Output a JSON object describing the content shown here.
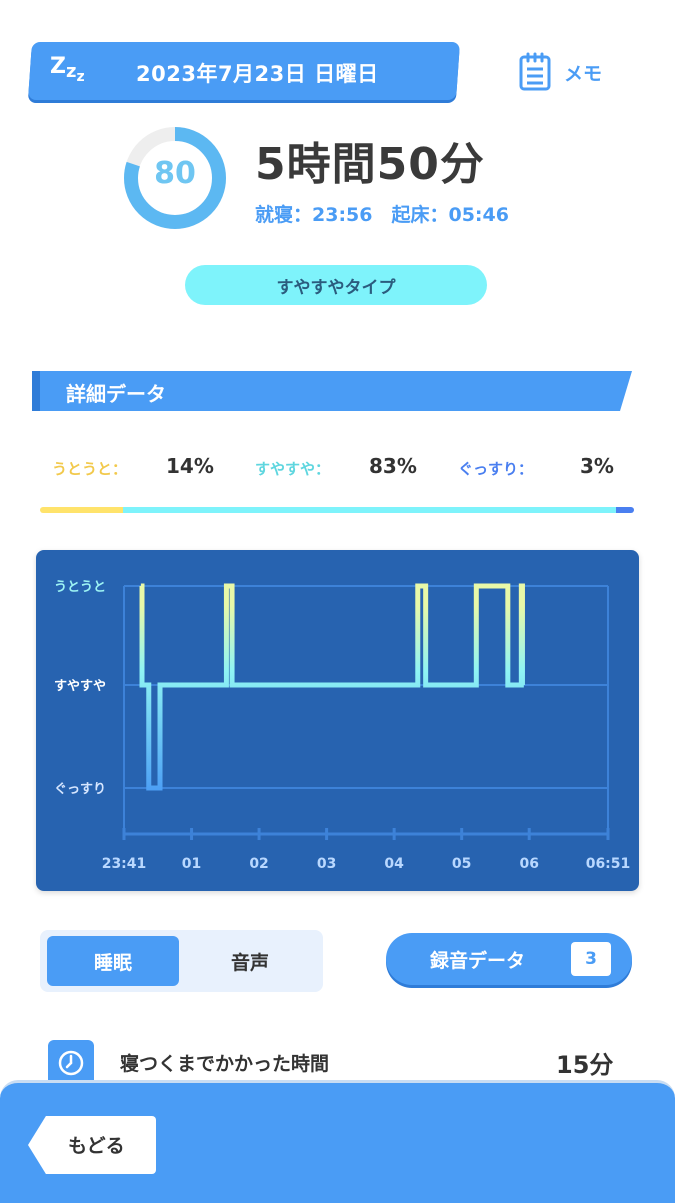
{
  "header": {
    "sleep_icon_text": "Zzz",
    "date": "2023年7月23日 日曜日",
    "memo_label": "メモ"
  },
  "summary": {
    "score": "80",
    "score_fraction": 0.8,
    "duration": "5時間50分",
    "bed_wake": "就寝：23:56　起床：05:46",
    "sleep_type": "すやすやタイプ"
  },
  "details": {
    "section_title": "詳細データ",
    "ratios": [
      {
        "label": "うとうと：",
        "value": "14%",
        "color": "#ffe36b",
        "fraction": 0.14
      },
      {
        "label": "すやすや：",
        "value": "83%",
        "color": "#7ef3fb",
        "fraction": 0.83
      },
      {
        "label": "ぐっすり：",
        "value": "3%",
        "color": "#4a7ff0",
        "fraction": 0.03
      }
    ]
  },
  "chart_data": {
    "type": "line",
    "title": "",
    "y_levels": [
      "うとうと",
      "すやすや",
      "ぐっすり"
    ],
    "x_tick_labels": [
      "23:41",
      "01",
      "02",
      "03",
      "04",
      "05",
      "06",
      "06:51"
    ],
    "x_range_minutes": [
      -19,
      411
    ],
    "series": [
      {
        "steps": [
          {
            "t": -4,
            "level": "うとうと"
          },
          {
            "t": -3,
            "level": "すやすや"
          },
          {
            "t": 0,
            "level": "すやすや"
          },
          {
            "t": 3,
            "level": "ぐっすり"
          },
          {
            "t": 13,
            "level": "すやすや"
          },
          {
            "t": 72,
            "level": "うとうと"
          },
          {
            "t": 77,
            "level": "すやすや"
          },
          {
            "t": 242,
            "level": "うとうと"
          },
          {
            "t": 249,
            "level": "すやすや"
          },
          {
            "t": 294,
            "level": "うとうと"
          },
          {
            "t": 322,
            "level": "すやすや"
          },
          {
            "t": 334,
            "level": "うとうと"
          },
          {
            "t": 335,
            "level": "すやすや"
          },
          {
            "t": 336,
            "level": "すやすや"
          }
        ]
      }
    ],
    "colors": {
      "background": "#2763b0",
      "grid": "#3d82d8",
      "top": "#e8f8a8",
      "bottom": "#4a9cf5"
    }
  },
  "tabs": {
    "sleep": "睡眠",
    "sound": "音声"
  },
  "recording": {
    "label": "録音データ",
    "count": "3"
  },
  "info": {
    "label": "寝つくまでかかった時間",
    "value": "15分"
  },
  "bottom": {
    "back_label": "もどる"
  }
}
